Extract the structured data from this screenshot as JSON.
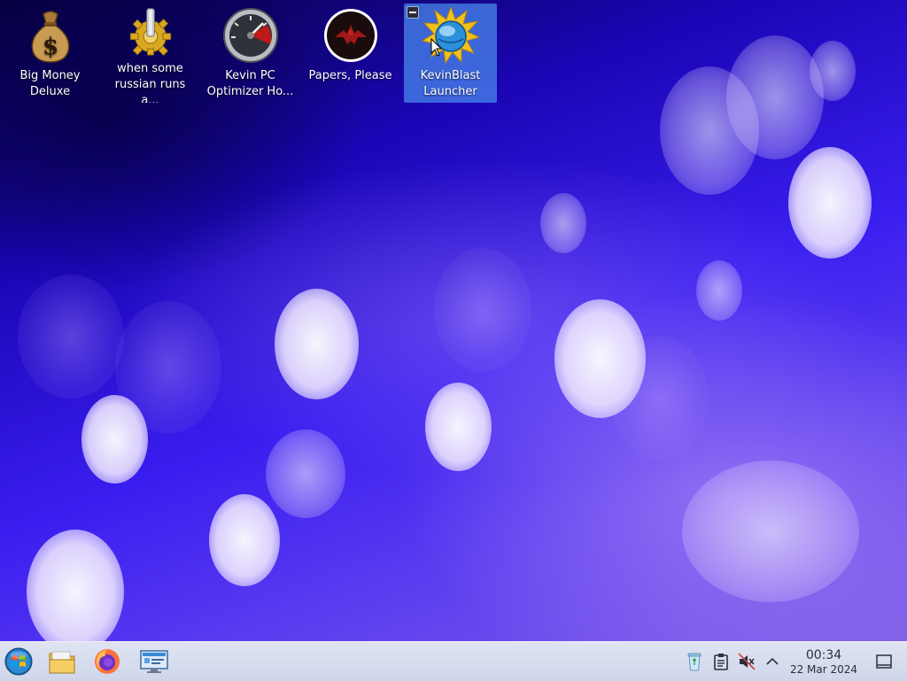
{
  "desktop": {
    "icons": [
      {
        "label": "Big Money Deluxe",
        "icon": "money-bag-icon"
      },
      {
        "label": "when some russian runs a...",
        "icon": "gear-icon"
      },
      {
        "label": "Kevin PC Optimizer Ho...",
        "icon": "speedometer-icon"
      },
      {
        "label": "Papers, Please",
        "icon": "eagle-emblem-icon"
      },
      {
        "label": "KevinBlast Launcher",
        "icon": "starburst-globe-icon",
        "selected": true
      }
    ]
  },
  "taskbar": {
    "launchers": [
      {
        "name": "start-menu",
        "icon": "windows-orb-icon"
      },
      {
        "name": "file-manager",
        "icon": "folder-icon"
      },
      {
        "name": "web-browser",
        "icon": "firefox-icon"
      },
      {
        "name": "system-settings",
        "icon": "control-panel-icon"
      }
    ],
    "tray": [
      "recycle-bin-icon",
      "clipboard-icon",
      "volume-muted-icon",
      "chevron-up-icon"
    ],
    "clock": {
      "time": "00:34",
      "date": "22 Mar 2024"
    }
  },
  "colors": {
    "wallpaper_dark": "#06003e",
    "wallpaper_mid": "#3a1ef0",
    "selection": "#4b8cf0",
    "taskbar": "#d6dcef"
  }
}
